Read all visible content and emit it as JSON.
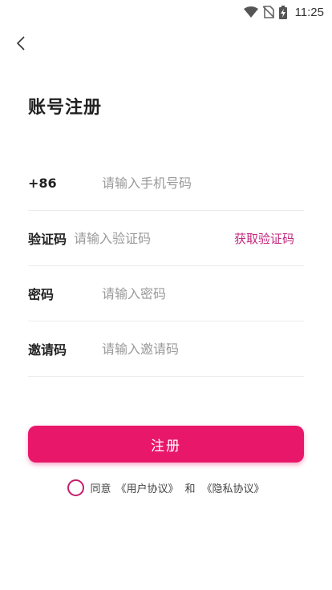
{
  "status_bar": {
    "time": "11:25"
  },
  "header": {
    "title": "账号注册"
  },
  "form": {
    "phone": {
      "label": "+86",
      "placeholder": "请输入手机号码"
    },
    "code": {
      "label": "验证码",
      "placeholder": "请输入验证码",
      "action": "获取验证码"
    },
    "password": {
      "label": "密码",
      "placeholder": "请输入密码"
    },
    "invite": {
      "label": "邀请码",
      "placeholder": "请输入邀请码"
    }
  },
  "register_button": {
    "label": "注册"
  },
  "agreement": {
    "prefix": "同意",
    "user_agreement": "《用户协议》",
    "and": "和",
    "privacy_agreement": "《隐私协议》"
  },
  "colors": {
    "accent": "#e8176a",
    "link": "#c4287e"
  }
}
